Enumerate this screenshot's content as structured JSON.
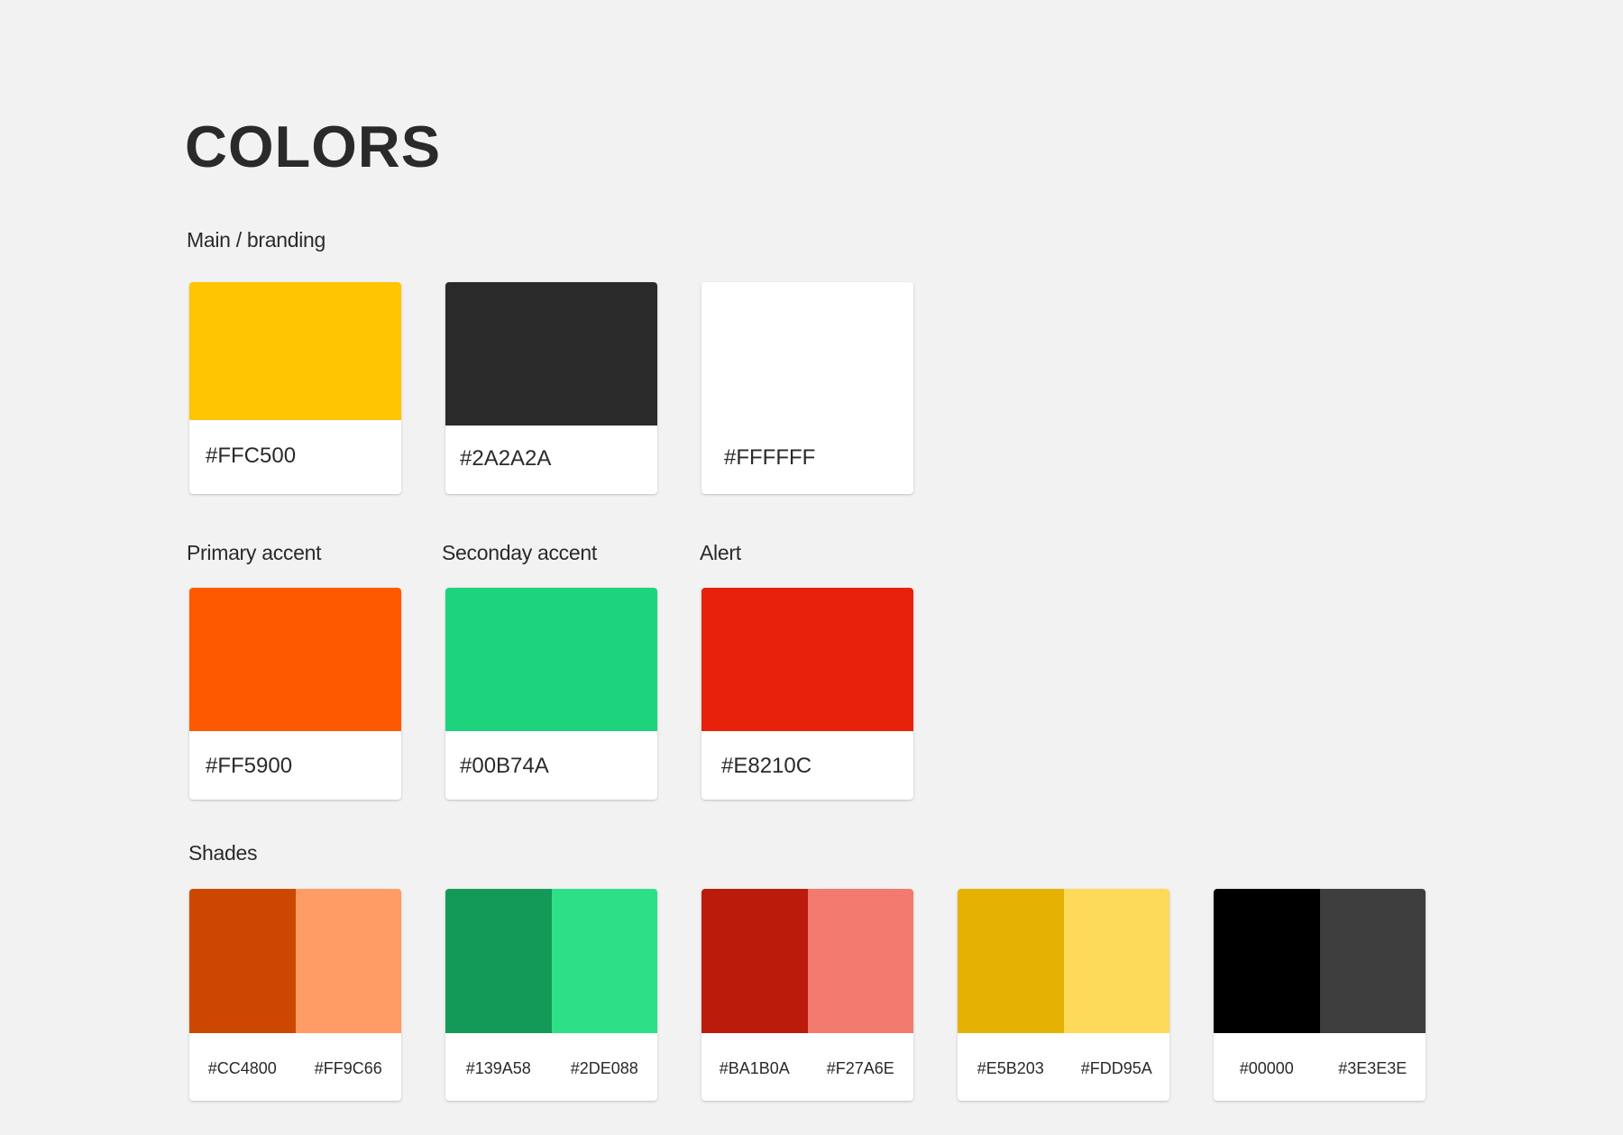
{
  "title": "COLORS",
  "sections": {
    "main": {
      "label": "Main / branding",
      "swatches": [
        {
          "color": "#FFC500",
          "hex": "#FFC500"
        },
        {
          "color": "#2A2A2A",
          "hex": "#2A2A2A"
        },
        {
          "color": "#FFFFFF",
          "hex": "#FFFFFF"
        }
      ]
    },
    "primary_accent": {
      "label": "Primary accent",
      "swatch": {
        "color": "#FF5900",
        "hex": "#FF5900"
      }
    },
    "secondary_accent": {
      "label": "Seconday accent",
      "swatch": {
        "color": "#1ED37E",
        "hex": "#00B74A"
      }
    },
    "alert": {
      "label": "Alert",
      "swatch": {
        "color": "#E8210C",
        "hex": "#E8210C"
      }
    },
    "shades": {
      "label": "Shades",
      "pairs": [
        {
          "dark": {
            "color": "#CC4800",
            "hex": "#CC4800"
          },
          "light": {
            "color": "#FF9C66",
            "hex": "#FF9C66"
          }
        },
        {
          "dark": {
            "color": "#139A58",
            "hex": "#139A58"
          },
          "light": {
            "color": "#2DE088",
            "hex": "#2DE088"
          }
        },
        {
          "dark": {
            "color": "#BA1B0A",
            "hex": "#BA1B0A"
          },
          "light": {
            "color": "#F27A6E",
            "hex": "#F27A6E"
          }
        },
        {
          "dark": {
            "color": "#E5B203",
            "hex": "#E5B203"
          },
          "light": {
            "color": "#FDD95A",
            "hex": "#FDD95A"
          }
        },
        {
          "dark": {
            "color": "#000000",
            "hex": "#00000"
          },
          "light": {
            "color": "#3E3E3E",
            "hex": "#3E3E3E"
          }
        }
      ]
    }
  }
}
